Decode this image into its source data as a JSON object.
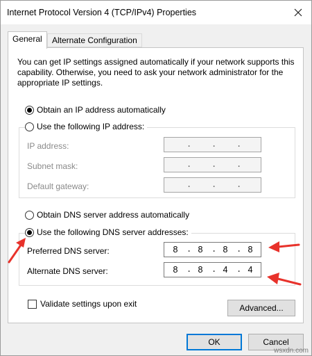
{
  "window": {
    "title": "Internet Protocol Version 4 (TCP/IPv4) Properties",
    "close_icon": "close-icon"
  },
  "tabs": [
    {
      "label": "General",
      "active": true
    },
    {
      "label": "Alternate Configuration",
      "active": false
    }
  ],
  "intro_text": "You can get IP settings assigned automatically if your network supports this capability. Otherwise, you need to ask your network administrator for the appropriate IP settings.",
  "ip_section": {
    "auto_label": "Obtain an IP address automatically",
    "auto_selected": true,
    "manual_label": "Use the following IP address:",
    "manual_selected": false,
    "fields": [
      {
        "label": "IP address:",
        "value": [
          "",
          "",
          "",
          ""
        ]
      },
      {
        "label": "Subnet mask:",
        "value": [
          "",
          "",
          "",
          ""
        ]
      },
      {
        "label": "Default gateway:",
        "value": [
          "",
          "",
          "",
          ""
        ]
      }
    ]
  },
  "dns_section": {
    "auto_label": "Obtain DNS server address automatically",
    "auto_selected": false,
    "manual_label": "Use the following DNS server addresses:",
    "manual_selected": true,
    "preferred": {
      "label": "Preferred DNS server:",
      "value": [
        "8",
        "8",
        "8",
        "8"
      ]
    },
    "alternate": {
      "label": "Alternate DNS server:",
      "value": [
        "8",
        "8",
        "4",
        "4"
      ]
    }
  },
  "validate": {
    "label": "Validate settings upon exit",
    "checked": false
  },
  "buttons": {
    "advanced": "Advanced...",
    "ok": "OK",
    "cancel": "Cancel"
  },
  "annotation_color": "#e8322b",
  "watermark": "wsxdn.com"
}
